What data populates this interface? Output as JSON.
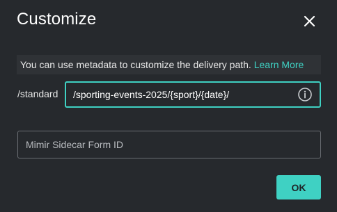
{
  "dialog": {
    "title": "Customize",
    "close_icon": "close-icon"
  },
  "banner": {
    "text": "You can use metadata to customize the delivery path. ",
    "link_label": "Learn More"
  },
  "path": {
    "prefix": "/standard",
    "value": "/sporting-events-2025/{sport}/{date}/",
    "info_icon": "info-icon"
  },
  "sidecar": {
    "placeholder": "Mimir Sidecar Form ID",
    "value": ""
  },
  "actions": {
    "ok_label": "OK"
  },
  "colors": {
    "accent": "#3fd1c3",
    "background": "#26292d",
    "banner": "#2f3236",
    "field_border": "#6b6f74"
  }
}
